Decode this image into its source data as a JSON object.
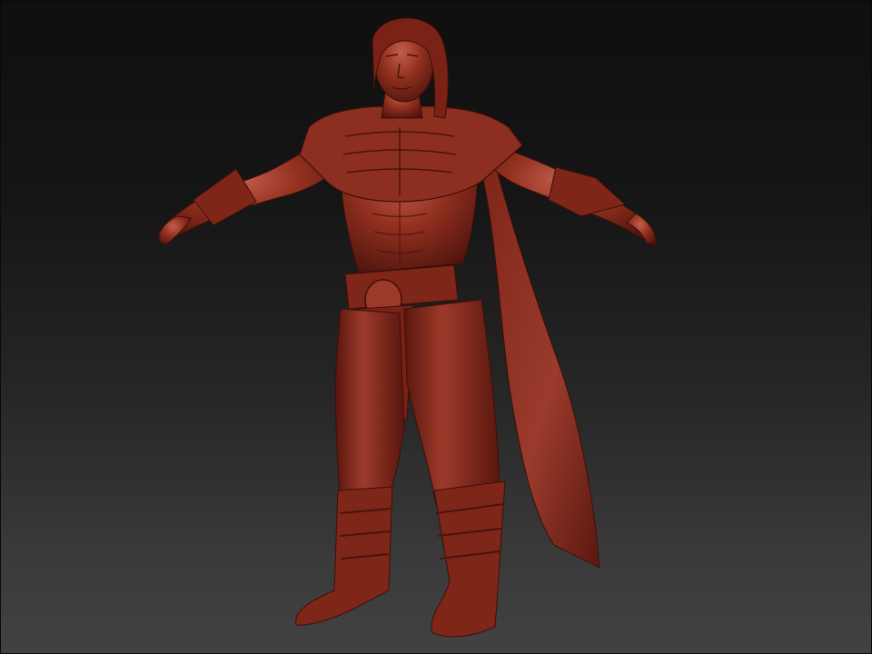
{
  "viewport": {
    "background_top": "#0f0f0f",
    "background_bottom": "#424242"
  },
  "model": {
    "material_color": "#8e2e22",
    "material_highlight": "#b85646",
    "material_shadow": "#4a130d"
  }
}
